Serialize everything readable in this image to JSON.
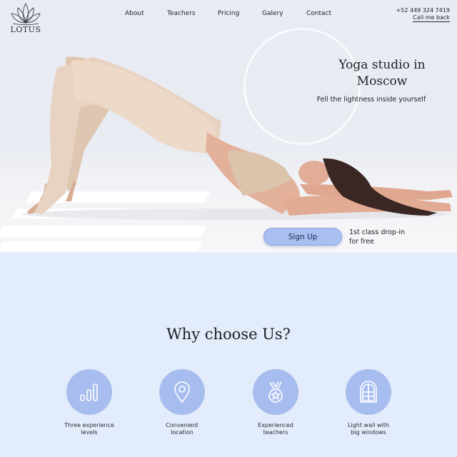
{
  "brand": {
    "name": "LOTUS",
    "logo_icon": "lotus-icon"
  },
  "nav": {
    "items": [
      "About",
      "Teachers",
      "Pricing",
      "Galery",
      "Contact"
    ]
  },
  "contact": {
    "phone": "+52 449 324 7419",
    "callback_label": "Call me back"
  },
  "hero": {
    "title_line1": "Yoga studio in",
    "title_line2": "Moscow",
    "subtitle": "Fell the lightness inside yourself",
    "cta_label": "Sign Up",
    "offer_line1": "1st class drop-in",
    "offer_line2": "for free"
  },
  "why": {
    "heading": "Why choose Us?",
    "features": [
      {
        "icon": "bar-chart-icon",
        "line1": "Three experience",
        "line2": "levels"
      },
      {
        "icon": "location-pin-icon",
        "line1": "Convenient",
        "line2": "location"
      },
      {
        "icon": "medal-icon",
        "line1": "Experienced",
        "line2": "teachers"
      },
      {
        "icon": "window-icon",
        "line1": "Light wall with",
        "line2": "big windows"
      }
    ]
  },
  "colors": {
    "accent": "#a8bdef",
    "page_bg": "#e3ecfa",
    "text": "#1d1d24"
  }
}
